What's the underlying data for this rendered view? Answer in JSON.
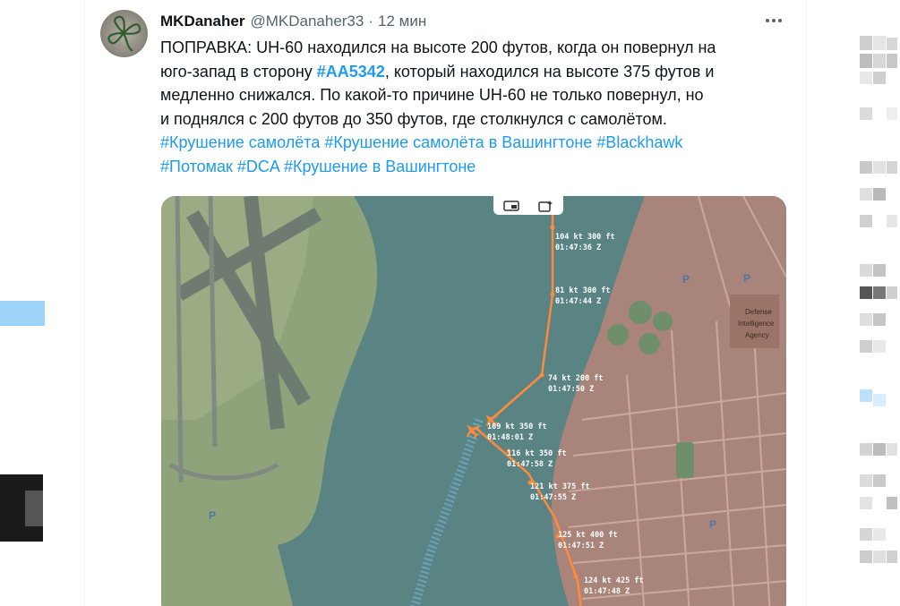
{
  "tweet": {
    "name": "MKDanaher",
    "handle": "@MKDanaher33",
    "separator": "·",
    "time": "12 мин",
    "line1": "ПОПРАВКА: UH-60 находился на высоте 200 футов, когда он повернул на",
    "line2_pre": "юго-запад в сторону ",
    "line2_tag": "#AA5342",
    "line2_post": ", который находился на высоте 375 футов и",
    "line3": "медленно снижался. По какой-то причине UH-60 не только повернул, но",
    "line4": "и поднялся с 200 футов до 350 футов, где столкнулся с самолётом.",
    "tags_line1": [
      "#Крушение самолёта",
      "#Крушение самолёта в Вашингтоне",
      "#Blackhawk"
    ],
    "tags_line2": [
      "#Потомак",
      "#DCA",
      "#Крушение в Вашингтоне"
    ]
  },
  "media": {
    "map_labels": {
      "defense": "Defense",
      "intelligence": "Intelligence",
      "agency": "Agency",
      "parking": "P"
    },
    "flight_points": [
      {
        "speed": "104 kt",
        "alt": "300 ft",
        "time": "01:47:36 Z"
      },
      {
        "speed": "81 kt",
        "alt": "300 ft",
        "time": "01:47:44 Z"
      },
      {
        "speed": "74 kt",
        "alt": "200 ft",
        "time": "01:47:50 Z"
      },
      {
        "speed": "109 kt",
        "alt": "350 ft",
        "time": "01:48:01 Z"
      },
      {
        "speed": "116 kt",
        "alt": "350 ft",
        "time": "01:47:58 Z"
      },
      {
        "speed": "121 kt",
        "alt": "375 ft",
        "time": "01:47:55 Z"
      },
      {
        "speed": "125 kt",
        "alt": "400 ft",
        "time": "01:47:51 Z"
      },
      {
        "speed": "124 kt",
        "alt": "425 ft",
        "time": "01:47:48 Z"
      }
    ],
    "colors": {
      "water": "#5a8483",
      "land_green": "#7f9a6a",
      "urban": "#a9847a",
      "track": "#ff8a3c"
    }
  }
}
